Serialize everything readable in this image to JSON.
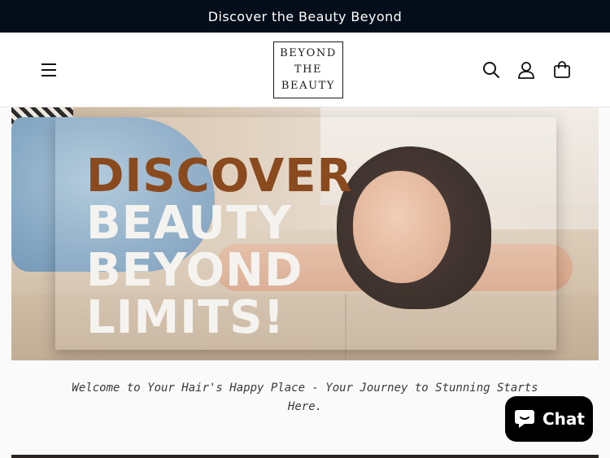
{
  "announcement": {
    "text": "Discover the Beauty Beyond"
  },
  "header": {
    "logo_lines": [
      "BEYOND",
      "THE",
      "BEAUTY"
    ],
    "icons": [
      "menu-icon",
      "search-icon",
      "account-icon",
      "cart-icon"
    ]
  },
  "hero": {
    "headline": [
      "DISCOVER",
      "BEAUTY",
      "BEYOND",
      "LIMITS!"
    ],
    "accent_color": "#8a4a1d"
  },
  "welcome": {
    "text": "Welcome to Your Hair's Happy Place - Your Journey to Stunning Starts Here."
  },
  "chat": {
    "label": "Chat"
  }
}
